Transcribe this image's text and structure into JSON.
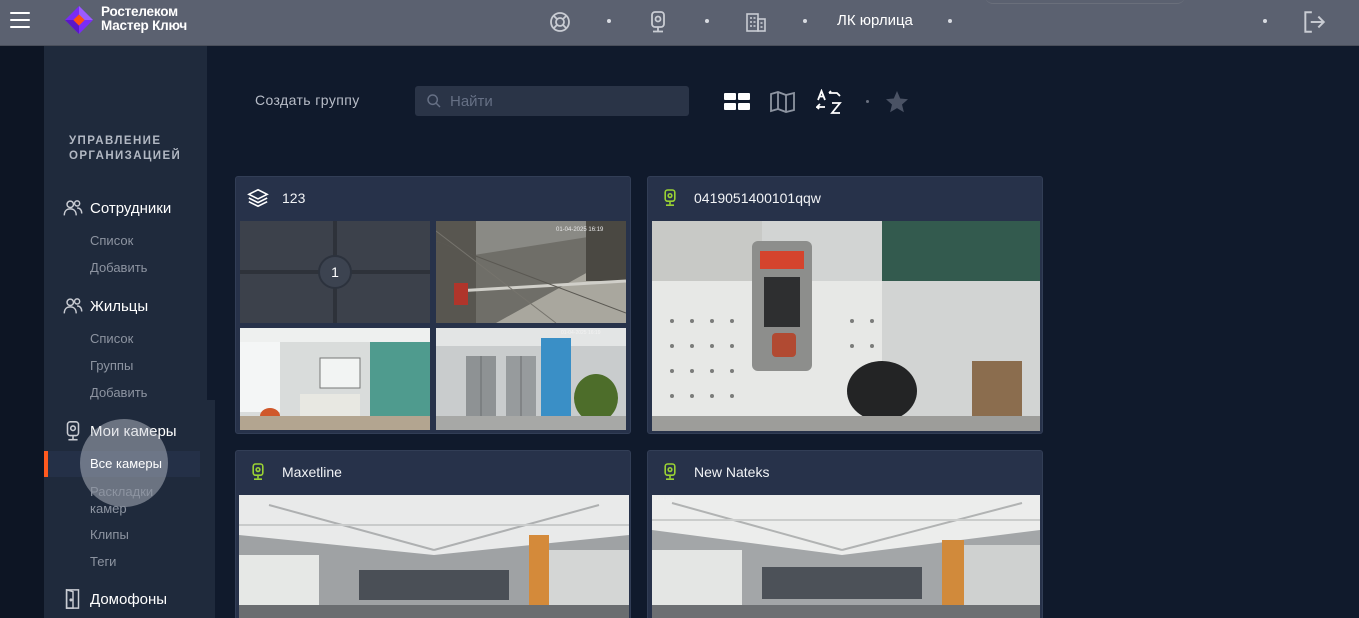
{
  "header": {
    "brand_line1": "Ростелеком",
    "brand_line2": "Мастер Ключ",
    "org_name": "ЛК юрлица",
    "icons": [
      "menu-icon",
      "support-icon",
      "camera-icon",
      "building-icon",
      "logout-icon"
    ]
  },
  "sidebar": {
    "section_title_line1": "УПРАВЛЕНИЕ",
    "section_title_line2": "ОРГАНИЗАЦИЕЙ",
    "groups": [
      {
        "label": "Сотрудники",
        "icon": "users-icon",
        "items": [
          "Список",
          "Добавить"
        ]
      },
      {
        "label": "Жильцы",
        "icon": "users-icon",
        "items": [
          "Список",
          "Группы",
          "Добавить"
        ]
      },
      {
        "label": "Мои камеры",
        "icon": "camera-icon",
        "items": [
          "Все камеры",
          "Раскладки камер",
          "Клипы",
          "Теги"
        ],
        "active_item": "Все камеры"
      },
      {
        "label": "Домофоны",
        "icon": "door-icon",
        "items": []
      }
    ]
  },
  "toolbar": {
    "create_group": "Создать группу",
    "search_placeholder": "Найти",
    "icons": [
      "grid-view-icon",
      "map-view-icon",
      "sort-az-icon",
      "favorite-star-icon"
    ]
  },
  "cards": [
    {
      "title": "123",
      "type": "group",
      "icon": "layers-icon",
      "grid_badge": "1"
    },
    {
      "title": "0419051400101qqw",
      "type": "camera",
      "icon": "camera-icon"
    },
    {
      "title": "Maxetline",
      "type": "camera",
      "icon": "camera-icon"
    },
    {
      "title": "New Nateks",
      "type": "camera",
      "icon": "camera-icon"
    }
  ],
  "colors": {
    "background": "#101a2c",
    "topbar": "#5b6170",
    "sidebar": "#1f2a3c",
    "card": "#27324a",
    "accent": "#ff5a1f",
    "camera_icon": "#9ad234"
  }
}
